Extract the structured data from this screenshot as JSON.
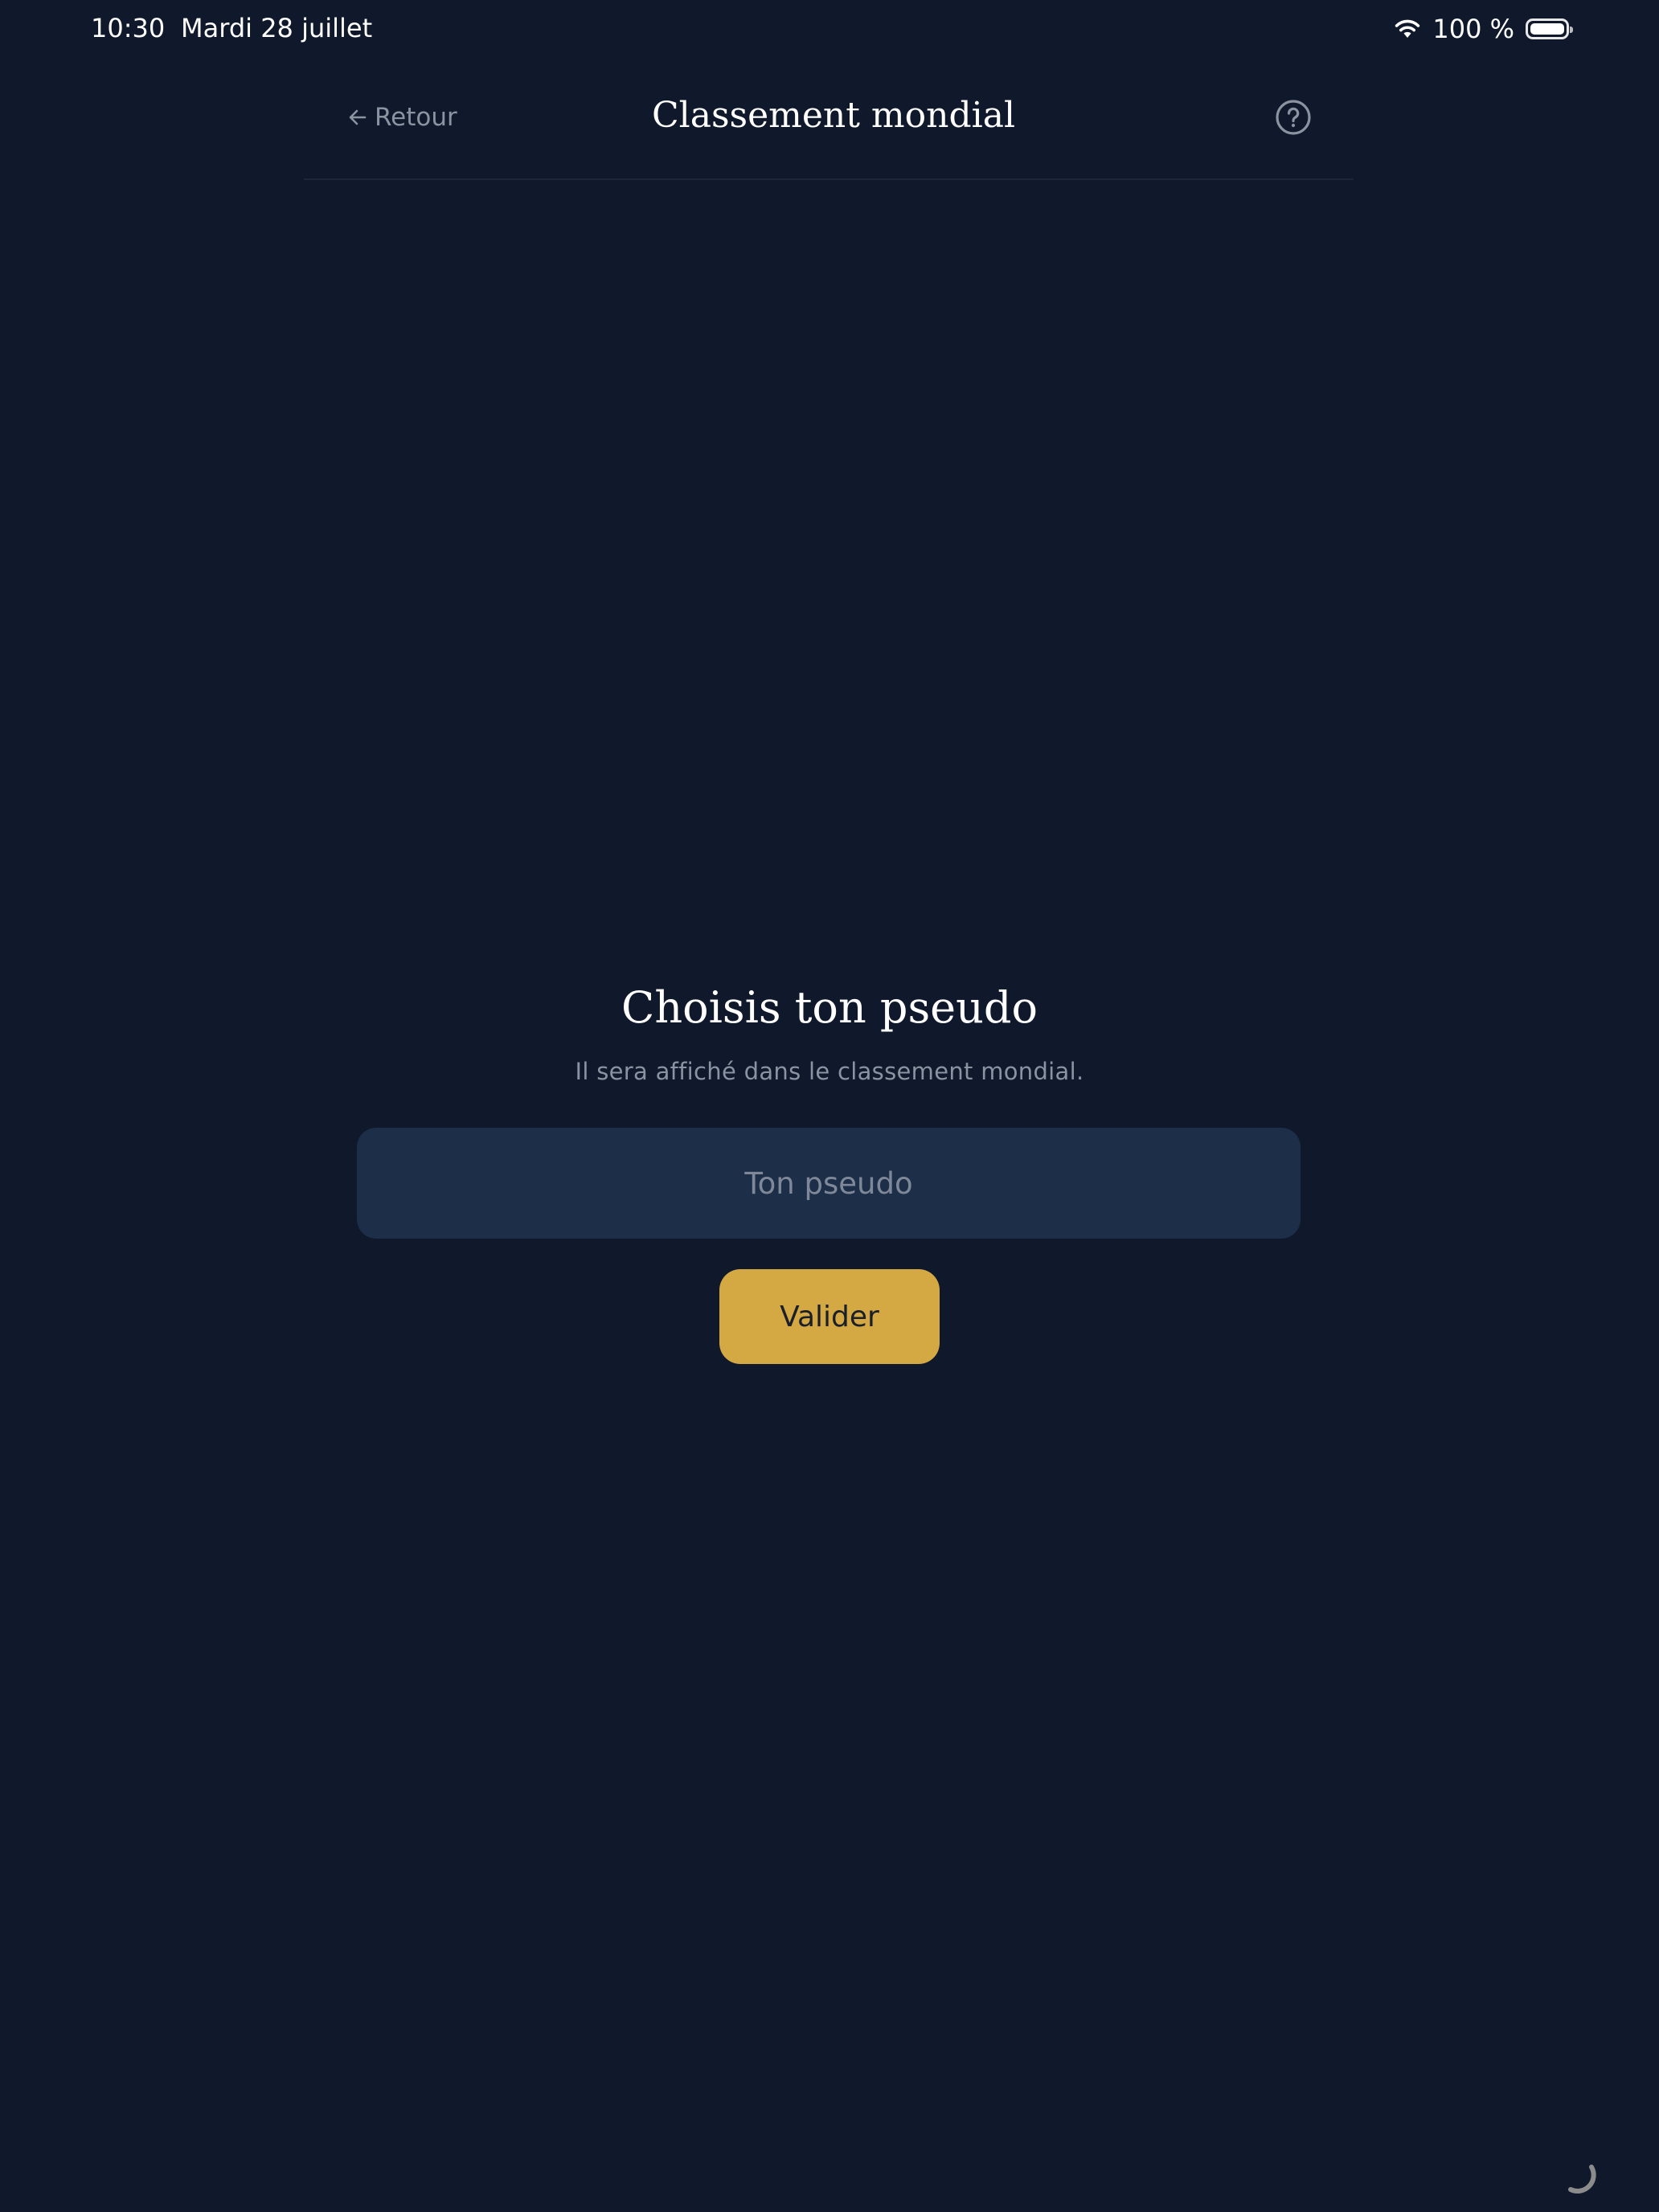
{
  "status_bar": {
    "time": "10:30",
    "date": "Mardi 28 juillet",
    "battery_percent": "100 %",
    "wifi_icon": "wifi-icon",
    "battery_icon": "battery-full-icon"
  },
  "header": {
    "back_label": "Retour",
    "back_icon": "arrow-left-icon",
    "title": "Classement mondial",
    "help_icon": "help-circle-icon"
  },
  "main": {
    "heading": "Choisis ton pseudo",
    "subtext": "Il sera affiché dans le classement mondial.",
    "pseudo_input": {
      "placeholder": "Ton pseudo",
      "value": ""
    },
    "submit_label": "Valider"
  },
  "colors": {
    "background": "#0f192b",
    "input_background": "#1c2e48",
    "accent": "#d4a843",
    "muted_text": "#8b93a1"
  }
}
